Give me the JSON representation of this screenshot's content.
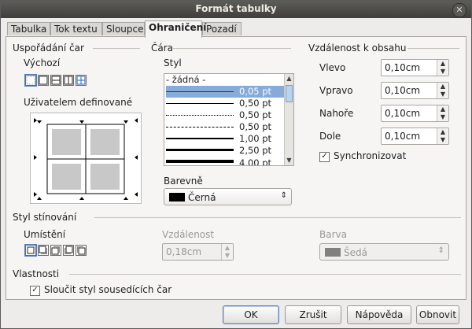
{
  "window": {
    "title": "Formát tabulky",
    "close_glyph": "✕"
  },
  "tabs": [
    {
      "label": "Tabulka"
    },
    {
      "label": "Tok textu"
    },
    {
      "label": "Sloupce"
    },
    {
      "label": "Ohraničení",
      "active": true
    },
    {
      "label": "Pozadí"
    }
  ],
  "line_arrangement": {
    "title": "Uspořádání čar",
    "default_label": "Výchozí",
    "user_label": "Uživatelem definované",
    "presets": [
      "no-borders-icon",
      "outer-border-icon",
      "outer-and-horizontal-icon",
      "outer-and-vertical-icon",
      "all-borders-icon"
    ],
    "selected_preset": 0
  },
  "line": {
    "title": "Čára",
    "style_label": "Styl",
    "styles": [
      {
        "label": "- žádná -"
      },
      {
        "label": "0,05 pt",
        "selected": true
      },
      {
        "label": "0,50 pt"
      },
      {
        "label": "0,50 pt"
      },
      {
        "label": "0,50 pt"
      },
      {
        "label": "1,00 pt"
      },
      {
        "label": "2,50 pt"
      },
      {
        "label": "4,00 pt"
      }
    ],
    "color_label": "Barevně",
    "color_value": "Černá",
    "color_swatch": "#000000"
  },
  "spacing": {
    "title": "Vzdálenost k obsahu",
    "left_label": "Vlevo",
    "left_value": "0,10cm",
    "right_label": "Vpravo",
    "right_value": "0,10cm",
    "top_label": "Nahoře",
    "top_value": "0,10cm",
    "bottom_label": "Dole",
    "bottom_value": "0,10cm",
    "sync_label": "Synchronizovat",
    "sync_checked": true
  },
  "shadow": {
    "title": "Styl stínování",
    "position_label": "Umístění",
    "distance_label": "Vzdálenost",
    "distance_value": "0,18cm",
    "color_label": "Barva",
    "color_value": "Šedá",
    "color_swatch": "#808080"
  },
  "properties": {
    "title": "Vlastnosti",
    "merge_label": "Sloučit styl sousedících čar",
    "merge_checked": true
  },
  "buttons": {
    "ok": "OK",
    "cancel": "Zrušit",
    "help": "Nápověda",
    "reset": "Obnovit"
  }
}
